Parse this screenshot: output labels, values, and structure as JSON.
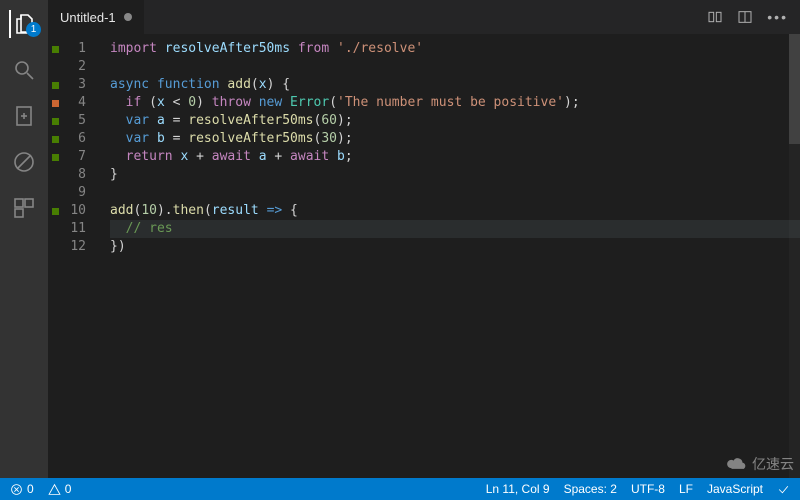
{
  "activity": {
    "badge": "1"
  },
  "tab": {
    "title": "Untitled-1"
  },
  "gutter": [
    "1",
    "2",
    "3",
    "4",
    "5",
    "6",
    "7",
    "8",
    "9",
    "10",
    "11",
    "12"
  ],
  "marks": [
    "g",
    "",
    "g",
    "o",
    "g",
    "g",
    "g",
    "",
    "",
    "g",
    "",
    ""
  ],
  "code": {
    "l1": {
      "kw_import": "import",
      "id": "resolveAfter50ms",
      "kw_from": "from",
      "str": "'./resolve'"
    },
    "l3": {
      "kw_async": "async",
      "kw_function": "function",
      "fn": "add",
      "p": "x"
    },
    "l4": {
      "kw_if": "if",
      "cond_l": "x",
      "op": "<",
      "cond_r": "0",
      "kw_throw": "throw",
      "kw_new": "new",
      "cls": "Error",
      "str": "'The number must be positive'"
    },
    "l5": {
      "kw_var": "var",
      "id": "a",
      "fn": "resolveAfter50ms",
      "arg": "60"
    },
    "l6": {
      "kw_var": "var",
      "id": "b",
      "fn": "resolveAfter50ms",
      "arg": "30"
    },
    "l7": {
      "kw_return": "return",
      "x": "x",
      "kw_await1": "await",
      "a": "a",
      "kw_await2": "await",
      "b": "b"
    },
    "l10": {
      "fn": "add",
      "arg": "10",
      "then": "then",
      "param": "result"
    },
    "l11": {
      "comment": "// res"
    }
  },
  "status": {
    "errors": "0",
    "warnings": "0",
    "lncol": "Ln 11, Col 9",
    "spaces": "Spaces: 2",
    "encoding": "UTF-8",
    "eol": "LF",
    "lang": "JavaScript"
  },
  "watermark": "亿速云"
}
